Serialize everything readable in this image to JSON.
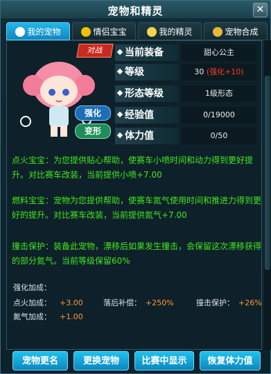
{
  "window": {
    "title": "宠物和精灵",
    "close": "✕"
  },
  "tabs": [
    {
      "label": "我的宠物",
      "icon": "paw-icon",
      "active": true
    },
    {
      "label": "情侣宝宝",
      "icon": "couple-icon"
    },
    {
      "label": "我的精灵",
      "icon": "sprite-icon"
    },
    {
      "label": "宠物合成",
      "icon": "compose-icon"
    }
  ],
  "pet": {
    "pvp_badge": "对战",
    "strengthen_badge": "强化",
    "transform_badge": "变形",
    "stats": [
      {
        "label": "当前装备",
        "value": "甜心公主"
      },
      {
        "label": "等级",
        "value": "30",
        "extra": "(强化+10)"
      },
      {
        "label": "形态等级",
        "value": "1级形态"
      },
      {
        "label": "经验值",
        "value": "0/19000"
      },
      {
        "label": "体力值",
        "value": "0/50"
      }
    ]
  },
  "descriptions": {
    "d1": "点火宝宝：为您提供贴心帮助，使赛车小喷时间和动力得到更好提升。对比赛车改装，当前提供小喷+7.00",
    "d2": "燃料宝宝：宠物为您提供帮助，使赛车氮气使用时间和推进力得到更好的提升。对比赛车改装，当前提供氮气+7.00",
    "d3": "撞击保护：装备此宠物，漂移后如果发生撞击，会保留这次漂移获得的部分氮气。当前等级保留60%"
  },
  "bonus": {
    "title": "强化加成：",
    "ignite_label": "点火加成：",
    "ignite_value": "+3.00",
    "fallback_label": "落后补偿：",
    "fallback_value": "+250%",
    "collide_label": "撞击保护：",
    "collide_value": "+26%",
    "nitro_label": "氮气加成：",
    "nitro_value": "+1.00"
  },
  "buttons": {
    "rename": "宠物更名",
    "swap": "更换宠物",
    "show_in_race": "比赛中显示",
    "restore_stamina": "恢复体力值"
  }
}
